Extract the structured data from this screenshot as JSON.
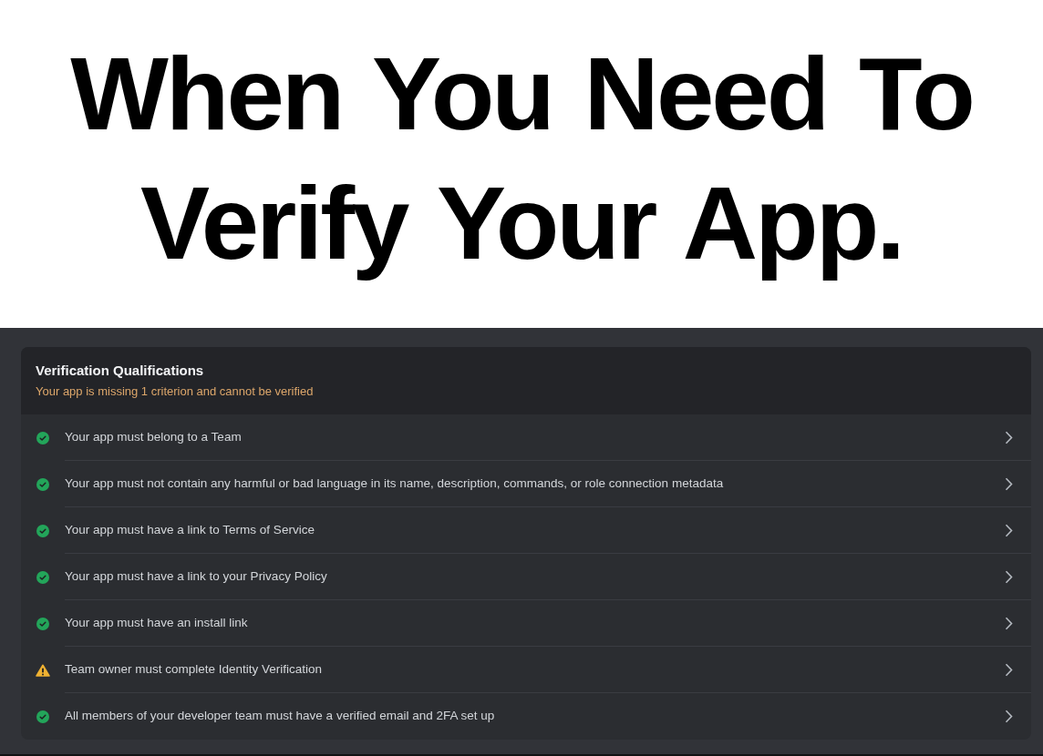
{
  "caption": {
    "lines": [
      "When You Need To",
      "Verify Your App."
    ]
  },
  "panel": {
    "title": "Verification Qualifications",
    "subtitle": "Your app is missing 1 criterion and cannot be verified",
    "criteria": [
      {
        "text": "Your app must belong to a Team",
        "met": true
      },
      {
        "text": "Your app must not contain any harmful or bad language in its name, description, commands, or role connection metadata",
        "met": true
      },
      {
        "text": "Your app must have a link to Terms of Service",
        "met": true
      },
      {
        "text": "Your app must have a link to your Privacy Policy",
        "met": true
      },
      {
        "text": "Your app must have an install link",
        "met": true
      },
      {
        "text": "Team owner must complete Identity Verification",
        "met": false
      },
      {
        "text": "All members of your developer team must have a verified email and 2FA set up",
        "met": true
      }
    ]
  }
}
